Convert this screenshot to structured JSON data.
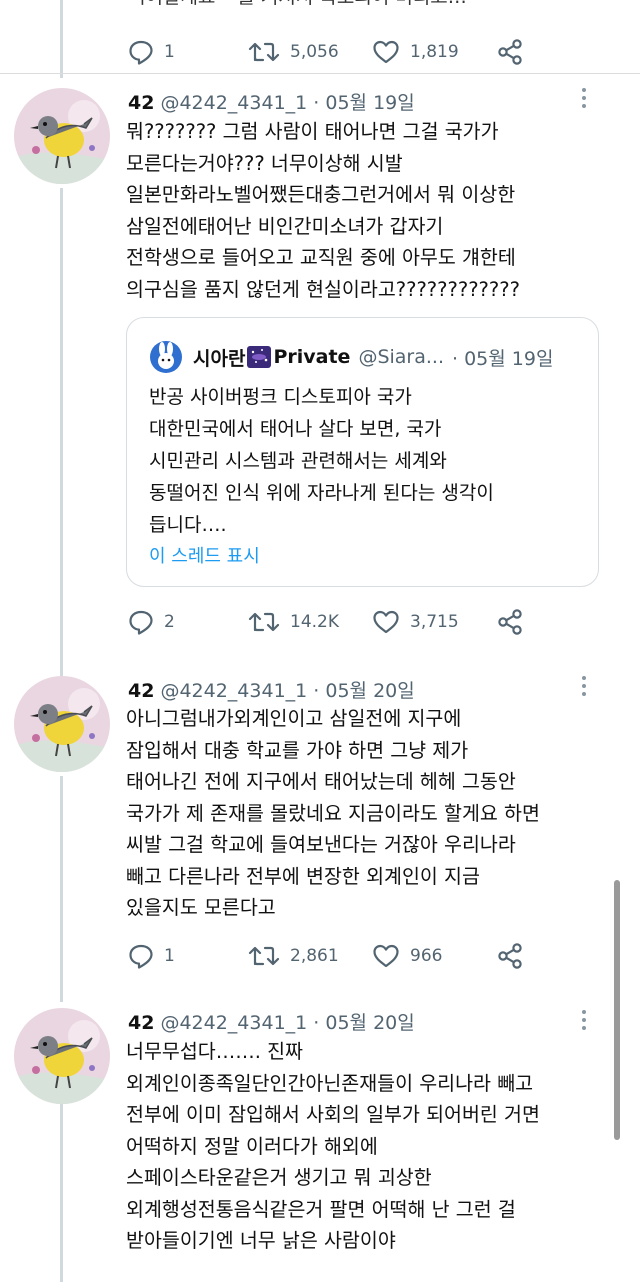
{
  "previous_tweet": {
    "text_partial": "씩어갈게요~ 를 거져서 폭로되어 버리고…",
    "stats": {
      "replies": "1",
      "retweets": "5,056",
      "likes": "1,819"
    }
  },
  "tweets": [
    {
      "name": "42",
      "handle": "@4242_4341_1",
      "date": "· 05월 19일",
      "lines": [
        "뭐??????? 그럼 사람이 태어나면 그걸 국가가",
        "모른다는거야??? 너무이상해 시발",
        "일본만화라노벨어쨌든대충그런거에서 뭐 이상한",
        "삼일전에태어난 비인간미소녀가 갑자기",
        "전학생으로 들어오고 교직원 중에 아무도 걔한테",
        "의구심을 품지 않던게 현실이라고????????????"
      ],
      "stats": {
        "replies": "2",
        "retweets": "14.2K",
        "likes": "3,715"
      }
    },
    {
      "name": "42",
      "handle": "@4242_4341_1",
      "date": "· 05월 20일",
      "lines": [
        "아니그럼내가외계인이고 삼일전에 지구에",
        "잠입해서 대충 학교를 가야 하면 그냥 제가",
        "태어나긴 전에 지구에서 태어났는데 헤헤 그동안",
        "국가가 제 존재를 몰랐네요 지금이라도 할게요 하면",
        "씨발 그걸 학교에 들여보낸다는 거잖아 우리나라",
        "빼고 다른나라 전부에 변장한 외계인이 지금",
        "있을지도 모른다고"
      ],
      "stats": {
        "replies": "1",
        "retweets": "2,861",
        "likes": "966"
      }
    },
    {
      "name": "42",
      "handle": "@4242_4341_1",
      "date": "· 05월 20일",
      "lines": [
        "너무무섭다……. 진짜",
        "외계인이종족일단인간아닌존재들이 우리나라 빼고",
        "전부에 이미 잠입해서 사회의 일부가 되어버린 거면",
        "어떡하지 정말 이러다가 해외에",
        "스페이스타운같은거 생기고 뭐 괴상한",
        "외계행성전통음식같은거 팔면 어떡해 난 그런 걸",
        "받아들이기엔 너무 낡은 사람이야"
      ]
    }
  ],
  "quote": {
    "name": "시아란",
    "badge": "Private",
    "handle": "@Siara...",
    "date": "· 05월 19일",
    "lines": [
      "반공 사이버펑크 디스토피아 국가",
      "대한민국에서 태어나 살다 보면, 국가",
      "시민관리 시스템과 관련해서는 세계와",
      "동떨어진 인식 위에 자라나게 된다는 생각이",
      "듭니다…."
    ],
    "show_thread": "이 스레드 표시"
  },
  "icons": [
    "reply-icon",
    "retweet-icon",
    "like-icon",
    "share-icon",
    "more-icon",
    "avatar-bird-icon",
    "rabbit-avatar-icon"
  ],
  "colors": {
    "accent": "#1d9bf0",
    "text": "#111111",
    "muted": "#536471",
    "thread_line": "#cfd9de"
  }
}
